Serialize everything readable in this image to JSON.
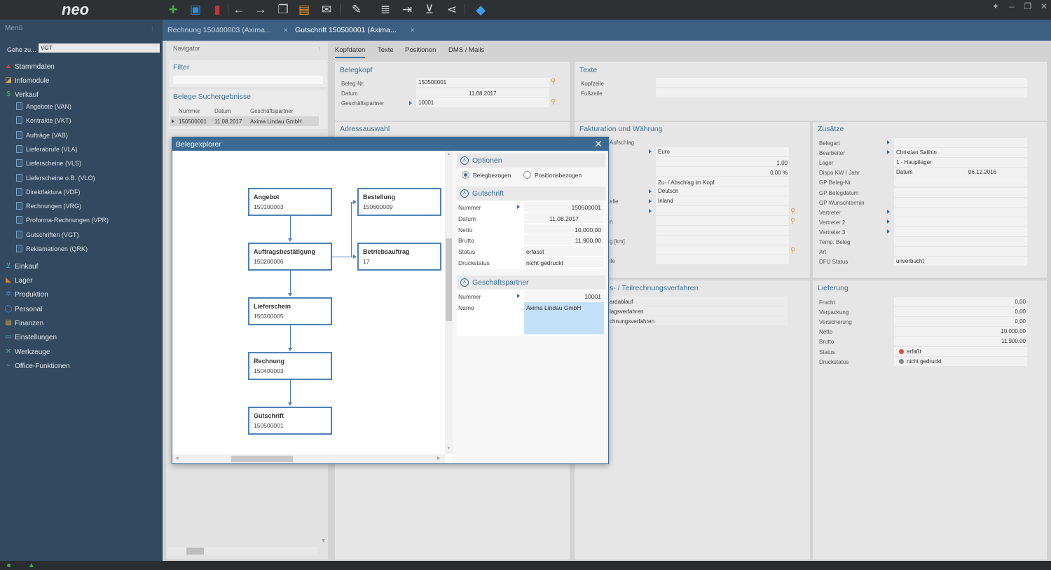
{
  "app": {
    "logo": "neo"
  },
  "sidebar": {
    "header": "Menü",
    "goto_label": "Gehe zu...",
    "goto_value": "VGT",
    "items": [
      {
        "label": "Stammdaten",
        "icon": "stammdaten-icon",
        "color": "#d64040"
      },
      {
        "label": "Infomodule",
        "icon": "chart-icon",
        "color": "#e0b040"
      },
      {
        "label": "Verkauf",
        "icon": "dollar-icon",
        "color": "#50b050"
      },
      {
        "label": "Einkauf",
        "icon": "cart-icon",
        "color": "#40a0e0"
      },
      {
        "label": "Lager",
        "icon": "forklift-icon",
        "color": "#e08030"
      },
      {
        "label": "Produktion",
        "icon": "gears-icon",
        "color": "#4090d0"
      },
      {
        "label": "Personal",
        "icon": "person-icon",
        "color": "#4090d0"
      },
      {
        "label": "Finanzen",
        "icon": "money-icon",
        "color": "#e0b040"
      },
      {
        "label": "Einstellungen",
        "icon": "monitor-icon",
        "color": "#40b0c0"
      },
      {
        "label": "Werkzeuge",
        "icon": "tools-icon",
        "color": "#40b090"
      },
      {
        "label": "Office-Funktionen",
        "icon": "office-icon",
        "color": "#8080c0"
      }
    ],
    "verkauf_sub": [
      "Angebote (VAN)",
      "Kontrakte (VKT)",
      "Aufträge (VAB)",
      "Lieferabrufe (VLA)",
      "Lieferscheine (VLS)",
      "Lieferscheine o.B. (VLO)",
      "Direktfaktura (VDF)",
      "Rechnungen (VRG)",
      "Proforma-Rechnungen (VPR)",
      "Gutschriften (VGT)",
      "Reklamationen (QRK)"
    ]
  },
  "tabs": [
    {
      "label": "Rechnung 150400003 (Axima..."
    },
    {
      "label": "Gutschrift 150500001 (Axima..."
    }
  ],
  "navigator": {
    "title": "Navigator",
    "filter_label": "Filter",
    "results_label": "Belege Suchergebnisse",
    "columns": [
      "Nummer",
      "Datum",
      "Geschäftspartner"
    ],
    "rows": [
      [
        "150500001",
        "11.08.2017",
        "Axima Lindau GmbH"
      ]
    ]
  },
  "detail_tabs": [
    "Kopfdaten",
    "Texte",
    "Positionen",
    "DMS / Mails"
  ],
  "belegkopf": {
    "title": "Belegkopf",
    "rows": [
      {
        "label": "Beleg-Nr.",
        "value": "150500001"
      },
      {
        "label": "Datum",
        "value": "11.08.2017"
      },
      {
        "label": "Geschäftspartner",
        "value": "10001"
      }
    ]
  },
  "texte": {
    "title": "Texte",
    "rows": [
      "Kopfzeile",
      "Fußzeile"
    ]
  },
  "adressauswahl": {
    "title": "Adressauswahl"
  },
  "fakturierung": {
    "title": "Fakturation und Währung",
    "frag1": "Aufschlag",
    "vals": [
      "Euro",
      "1,00",
      "0,00 %",
      "Zu- / Abschlag im Kopf",
      "Deutsch",
      "Inland"
    ],
    "frags": [
      "elle",
      "n",
      "g [km]",
      "ile"
    ]
  },
  "teilrechnung": {
    "title": "s- / Teilrechnungsverfahren",
    "rows": [
      "ardablauf",
      "lagsverfahren",
      "chnungsverfahren"
    ]
  },
  "zusaetze": {
    "title": "Zusätze",
    "rows": [
      {
        "label": "Belegart",
        "value": ""
      },
      {
        "label": "Bearbeiter",
        "value": "Christian Salihin"
      },
      {
        "label": "Lager",
        "value": "1 - Hauptlager"
      },
      {
        "label": "Dispo KW / Jahr",
        "value": "Datum",
        "value2": "06.12.2016"
      },
      {
        "label": "GP Beleg-Nr.",
        "value": ""
      },
      {
        "label": "GP Belegdatum",
        "value": ""
      },
      {
        "label": "GP Wunschtermin",
        "value": ""
      },
      {
        "label": "Vertreter",
        "value": ""
      },
      {
        "label": "Vertreter 2",
        "value": ""
      },
      {
        "label": "Vertreter 3",
        "value": ""
      },
      {
        "label": "Temp. Beleg",
        "value": ""
      },
      {
        "label": "Art",
        "value": ""
      },
      {
        "label": "DFÜ Status",
        "value": "unverbucht"
      }
    ]
  },
  "lieferung": {
    "title": "Lieferung",
    "rows": [
      {
        "label": "Fracht",
        "value": "0,00"
      },
      {
        "label": "Verpackung",
        "value": "0,00"
      },
      {
        "label": "Versicherung",
        "value": "0,00"
      },
      {
        "label": "Netto",
        "value": "10.000,00"
      },
      {
        "label": "Brutto",
        "value": "11.900,00"
      },
      {
        "label": "Status",
        "value": "erfaßt",
        "dot": "#d94a3a"
      },
      {
        "label": "Druckstatus",
        "value": "nicht gedruckt",
        "dot": "#888888"
      }
    ]
  },
  "modal": {
    "title": "Belegexplorer",
    "nodes": [
      {
        "name": "Angebot",
        "number": "150100003"
      },
      {
        "name": "Bestellung",
        "number": "150600009"
      },
      {
        "name": "Auftragsbestätigung",
        "number": "150200006"
      },
      {
        "name": "Betriebsauftrag",
        "number": "17"
      },
      {
        "name": "Lieferschein",
        "number": "150300005"
      },
      {
        "name": "Rechnung",
        "number": "150400003"
      },
      {
        "name": "Gutschrift",
        "number": "150500001"
      }
    ],
    "optionen": {
      "title": "Optionen",
      "radio1": "Belegbezogen",
      "radio2": "Positionsbezogen",
      "selected": "Belegbezogen"
    },
    "gutschrift": {
      "title": "Gutschrift",
      "rows": [
        {
          "label": "Nummer",
          "value": "150500001",
          "arrow": true,
          "align": "right"
        },
        {
          "label": "Datum",
          "value": "11.08.2017",
          "align": "center"
        },
        {
          "label": "Netto",
          "value": "10.000,00",
          "align": "right"
        },
        {
          "label": "Brutto",
          "value": "11.900,00",
          "align": "right"
        },
        {
          "label": "Status",
          "value": "erfasst",
          "align": "left"
        },
        {
          "label": "Druckstatus",
          "value": "nicht gedruckt",
          "align": "left"
        }
      ]
    },
    "partner": {
      "title": "Geschäftspartner",
      "nummer_label": "Nummer",
      "nummer": "10001",
      "name_label": "Name",
      "name": "Axima Lindau GmbH"
    }
  },
  "colors": {
    "accent": "#3e6f98",
    "tabbar": "#3c5f82",
    "sidebar": "#32495f"
  }
}
